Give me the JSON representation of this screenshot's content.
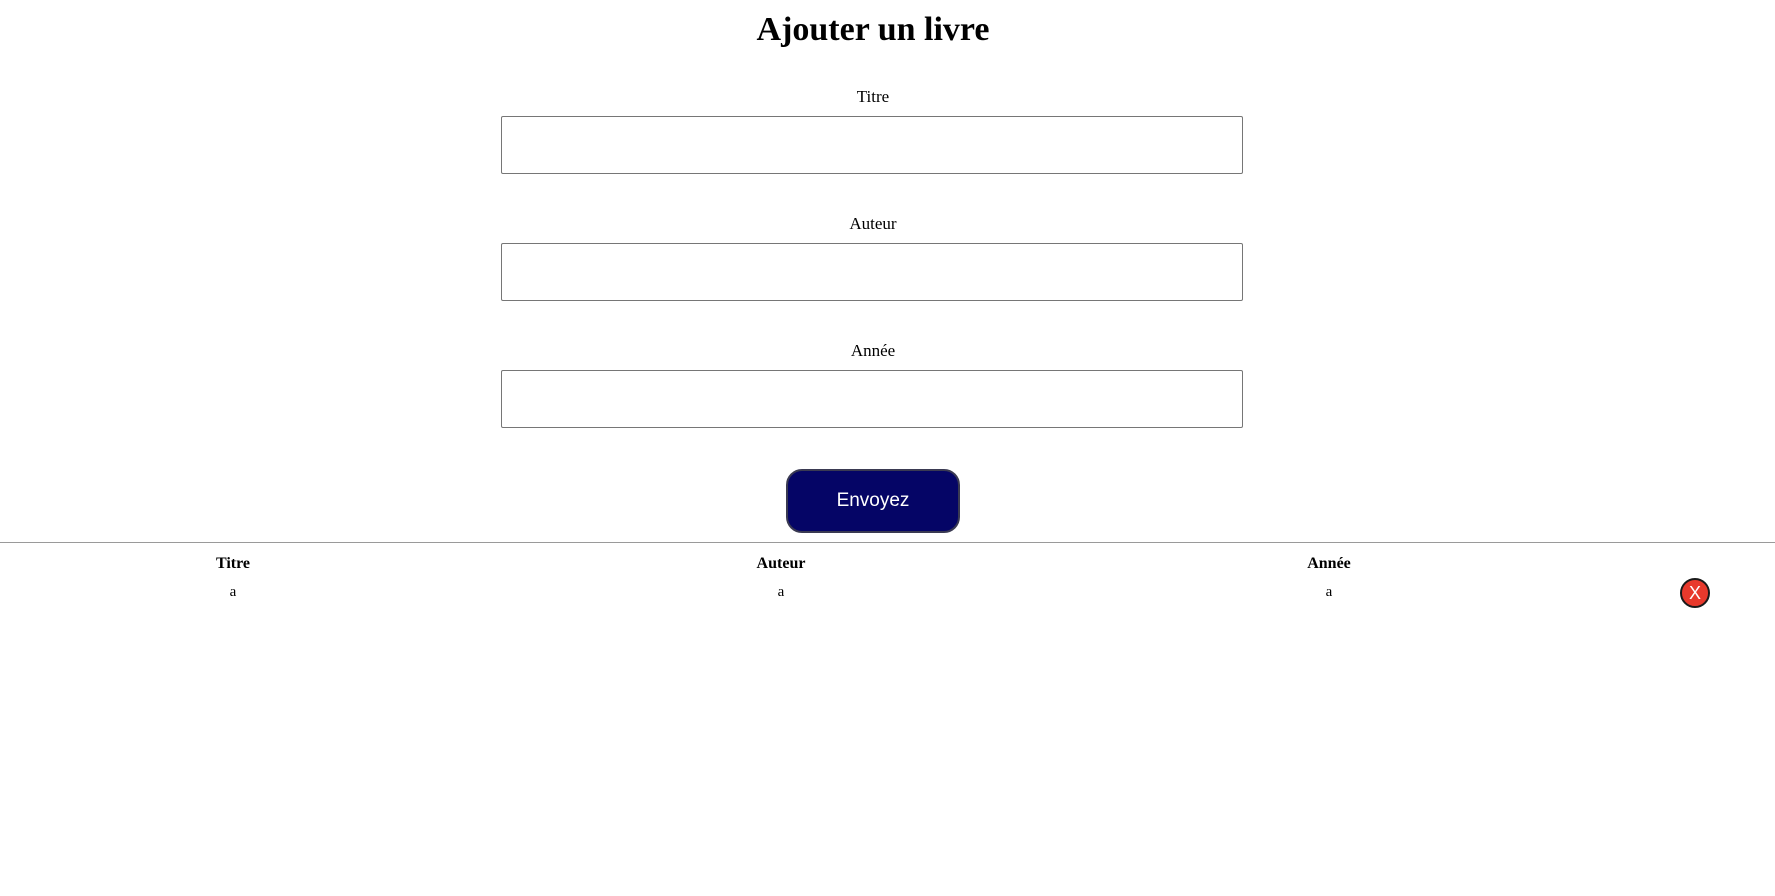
{
  "page": {
    "title": "Ajouter un livre"
  },
  "form": {
    "fields": [
      {
        "label": "Titre",
        "value": "",
        "placeholder": ""
      },
      {
        "label": "Auteur",
        "value": "",
        "placeholder": ""
      },
      {
        "label": "Année",
        "value": "",
        "placeholder": ""
      }
    ],
    "submit_label": "Envoyez"
  },
  "table": {
    "headers": [
      "Titre",
      "Auteur",
      "Année"
    ],
    "rows": [
      {
        "titre": "a",
        "auteur": "a",
        "annee": "a",
        "delete_label": "X"
      }
    ]
  },
  "colors": {
    "submit_bg": "#050566",
    "delete_bg": "#e8392c"
  }
}
